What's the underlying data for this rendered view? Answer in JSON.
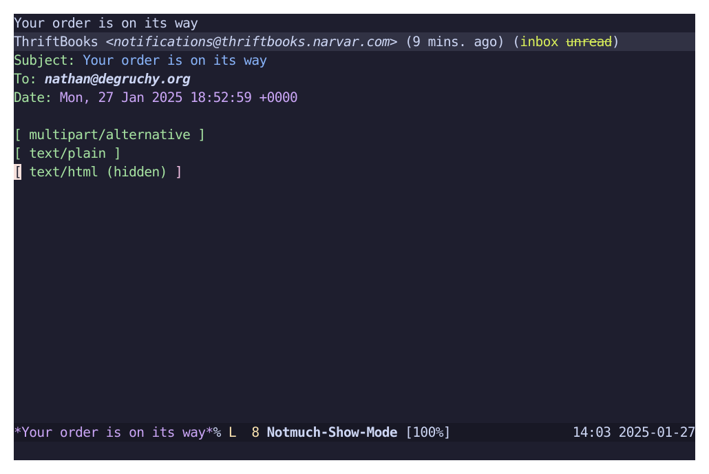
{
  "buffer": {
    "summary_line": "Your order is on its way",
    "from_name": "ThriftBooks",
    "from_email": "notifications@thriftbooks.narvar.com",
    "relative_time": "(9 mins. ago)",
    "tags": {
      "inbox": "inbox",
      "unread": "unread"
    },
    "subject_label": "Subject:",
    "subject_value": "Your order is on its way",
    "to_label": "To:",
    "to_value": "nathan@degruchy.org",
    "date_label": "Date:",
    "date_value": "Mon, 27 Jan 2025 18:52:59 +0000",
    "parts": [
      "multipart/alternative",
      "text/plain",
      "text/html (hidden)"
    ]
  },
  "modeline": {
    "buffer_name": "*Your order is on its way*",
    "status": "%",
    "line_label": "L",
    "line_number": "8",
    "major_mode": "Notmuch-Show-Mode",
    "position": "[100%]",
    "time": "14:03",
    "date": "2025-01-27"
  },
  "colors": {
    "background": "#1e1e2e",
    "header_highlight": "#313244",
    "foreground": "#cdd6f4",
    "green": "#a6e3a1",
    "blue": "#89b4fa",
    "mauve": "#cba6f7",
    "tag": "#d8ee5a"
  }
}
